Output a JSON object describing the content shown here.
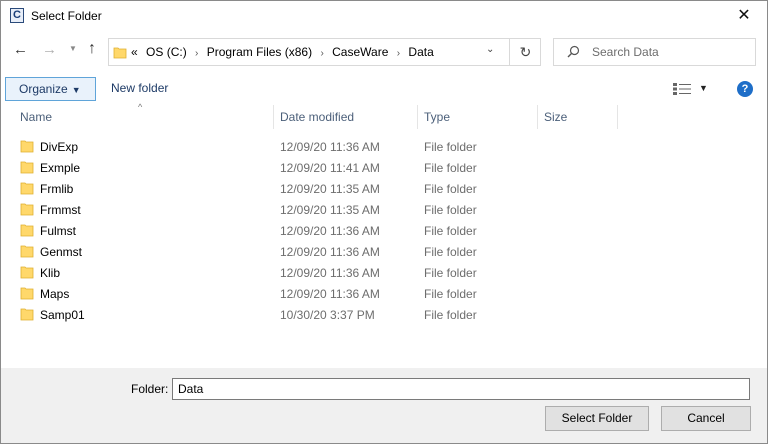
{
  "window": {
    "title": "Select Folder",
    "app_icon_letter": "C",
    "close_symbol": "✕"
  },
  "nav": {
    "back_symbol": "←",
    "forward_symbol": "→",
    "recent_symbol": "▼",
    "up_symbol": "↑"
  },
  "address": {
    "overflow": "«",
    "crumbs": [
      "OS (C:)",
      "Program Files (x86)",
      "CaseWare",
      "Data"
    ],
    "separator": "›",
    "dropdown_symbol": "⌄",
    "refresh_symbol": "↻"
  },
  "search": {
    "placeholder": "Search Data"
  },
  "toolbar": {
    "organize_label": "Organize",
    "organize_caret": "▼",
    "new_folder_label": "New folder",
    "view_caret": "▼",
    "help_symbol": "?"
  },
  "columns": {
    "sort_indicator": "^",
    "name": "Name",
    "date_modified": "Date modified",
    "type": "Type",
    "size": "Size"
  },
  "files": [
    {
      "name": "DivExp",
      "date": "12/09/20 11:36 AM",
      "type": "File folder"
    },
    {
      "name": "Exmple",
      "date": "12/09/20 11:41 AM",
      "type": "File folder"
    },
    {
      "name": "Frmlib",
      "date": "12/09/20 11:35 AM",
      "type": "File folder"
    },
    {
      "name": "Frmmst",
      "date": "12/09/20 11:35 AM",
      "type": "File folder"
    },
    {
      "name": "Fulmst",
      "date": "12/09/20 11:36 AM",
      "type": "File folder"
    },
    {
      "name": "Genmst",
      "date": "12/09/20 11:36 AM",
      "type": "File folder"
    },
    {
      "name": "Klib",
      "date": "12/09/20 11:36 AM",
      "type": "File folder"
    },
    {
      "name": "Maps",
      "date": "12/09/20 11:36 AM",
      "type": "File folder"
    },
    {
      "name": "Samp01",
      "date": "10/30/20 3:37 PM",
      "type": "File folder"
    }
  ],
  "footer": {
    "folder_label": "Folder:",
    "folder_value": "Data",
    "select_button": "Select Folder",
    "cancel_button": "Cancel"
  },
  "colors": {
    "folder_fill": "#ffd86b",
    "folder_edge": "#e0b030",
    "accent": "#1e6ec8",
    "footer_bg": "#f0f0f0"
  }
}
